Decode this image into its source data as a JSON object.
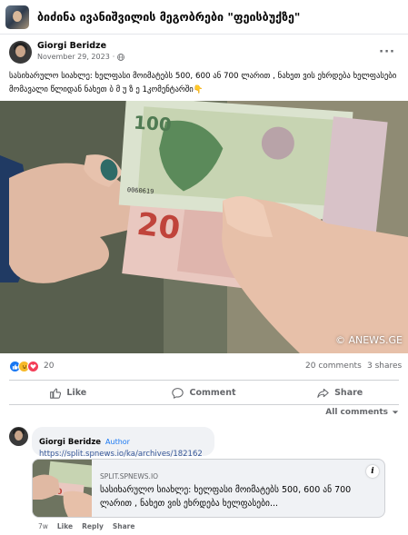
{
  "group": {
    "name": "ბიძინა ივანიშვილის მეგობრები \"ფეისბუქზე\""
  },
  "post": {
    "author": "Giorgi Beridze",
    "date": "November 29, 2023",
    "meta_separator": "·",
    "more": "···",
    "text": "სასიხარულო სიახლე: ხელფასი მოიმატებს 500, 600 ან 700 ლარით , ნახეთ ვის ეხრდება ხელფასები მომავალი წლიდან ნახეთ  ბ მ უ ზ ე   1კომენტარში",
    "emoji": "👇",
    "image_watermark": "© ANEWS.GE"
  },
  "reactions": {
    "count": "20",
    "comments": "20 comments",
    "shares": "3 shares"
  },
  "actions": {
    "like": "Like",
    "comment": "Comment",
    "share": "Share"
  },
  "sort": {
    "label": "All comments"
  },
  "comment": {
    "author": "Giorgi Beridze",
    "badge": "Author",
    "link": "https://split.spnews.io/ka/archives/182162",
    "card": {
      "domain": "SPLIT.SPNEWS.IO",
      "title": "სასიხარულო სიახლე: ხელფასი მოიმატებს 500, 600 ან 700 ლარით , ნახეთ ვის ეხრდება ხელფასები...",
      "info": "i"
    },
    "time": "7w",
    "like": "Like",
    "reply": "Reply",
    "share": "Share"
  },
  "colors": {
    "like_blue": "#1877f2",
    "haha_yellow": "#f7b928",
    "love_red": "#f33e58",
    "secondary_text": "#65676b",
    "link": "#385898"
  }
}
